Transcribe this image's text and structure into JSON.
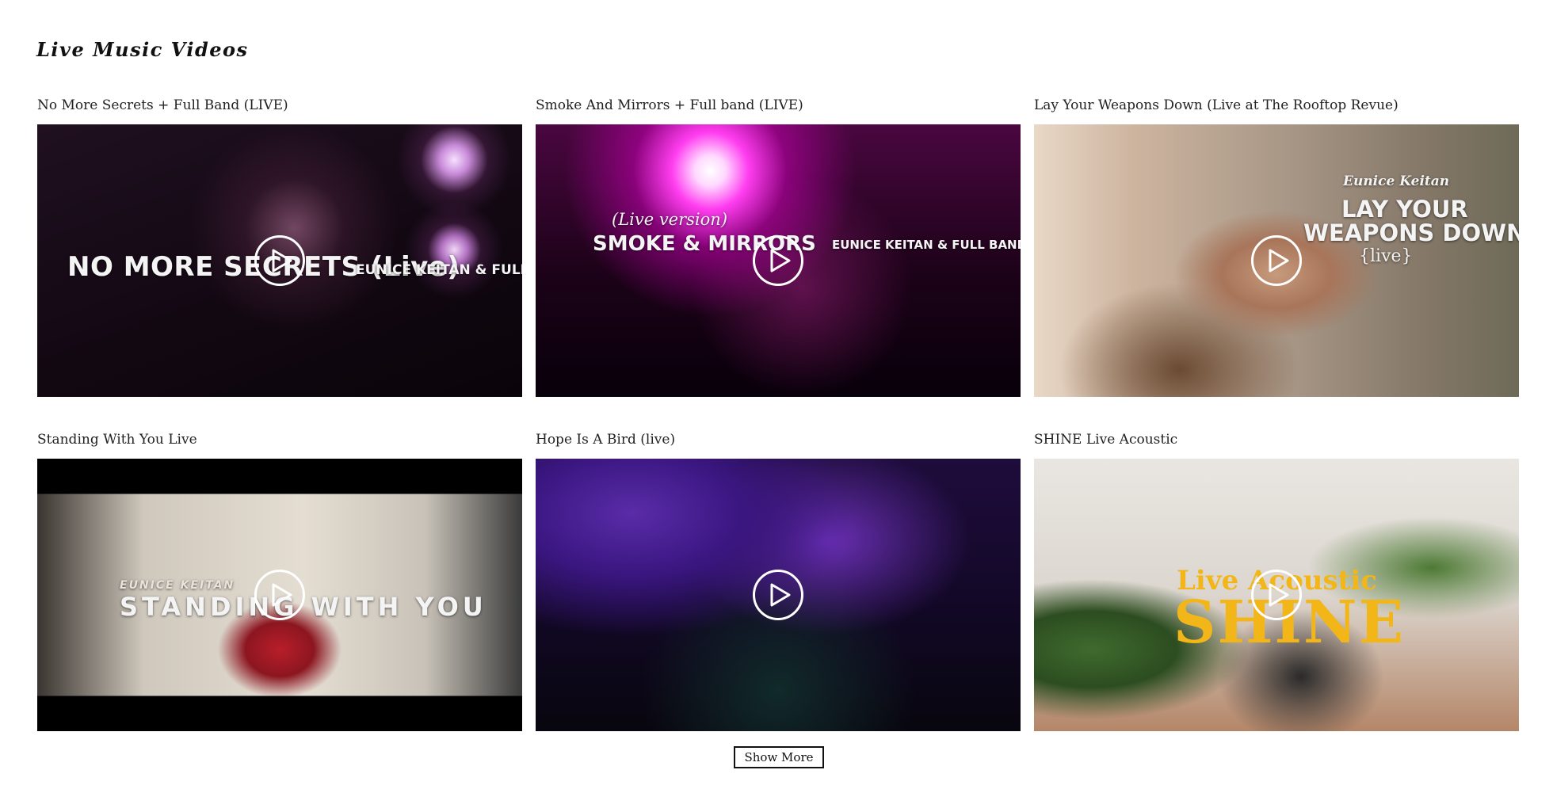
{
  "section": {
    "title": "Live Music Videos"
  },
  "videos": [
    {
      "title": "No More Secrets + Full Band (LIVE)",
      "overlay_main": "NO MORE SECRETS (Live)",
      "overlay_sub": "EUNICE KEITAN & FULL BAND"
    },
    {
      "title": "Smoke And Mirrors + Full band (LIVE)",
      "overlay_top": "(Live version)",
      "overlay_main": "SMOKE & MIRRORS",
      "overlay_sub": "EUNICE KEITAN & FULL BAND"
    },
    {
      "title": "Lay Your Weapons Down (Live at The Rooftop Revue)",
      "overlay_top": "Eunice Keitan",
      "overlay_main": "LAY YOUR",
      "overlay_main2": "WEAPONS DOWN",
      "overlay_sub": "{live}"
    },
    {
      "title": "Standing With You Live",
      "overlay_top": "EUNICE KEITAN",
      "overlay_main": "STANDING WITH YOU"
    },
    {
      "title": "Hope Is A Bird (live)"
    },
    {
      "title": "SHINE Live Acoustic",
      "overlay_top": "Live Acoustic",
      "overlay_main": "SHINE"
    }
  ],
  "show_more": {
    "label": "Show More"
  },
  "icons": {
    "play": "play-circle-icon"
  },
  "colors": {
    "shine_yellow": "#f3b619",
    "border": "#111111"
  }
}
